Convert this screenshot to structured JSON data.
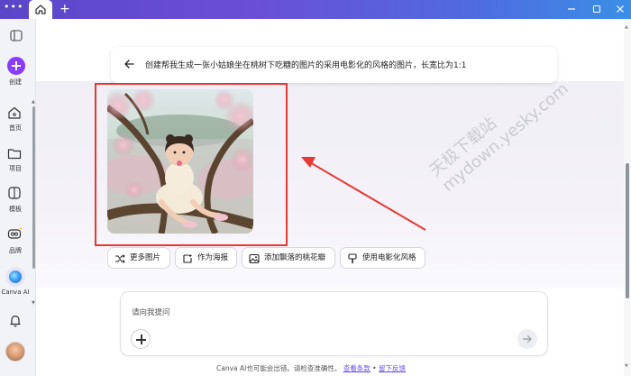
{
  "titlebar": {
    "menu_label": "•••",
    "new_tab_label": "+",
    "window_controls": [
      "minimize-icon",
      "maximize-icon",
      "close-icon"
    ]
  },
  "sidebar": {
    "create_label": "创建",
    "items": [
      {
        "label": "首页",
        "icon": "home-icon"
      },
      {
        "label": "项目",
        "icon": "folder-icon"
      },
      {
        "label": "模板",
        "icon": "template-icon"
      },
      {
        "label": "品牌",
        "icon": "brand-icon"
      },
      {
        "label": "Canva AI",
        "icon": "canva-ai-icon"
      }
    ]
  },
  "prompt": {
    "text": "创建帮我生成一张小姑娘坐在桃树下吃糖的图片的采用电影化的风格的图片，长宽比为1:1"
  },
  "chips": [
    {
      "label": "更多图片",
      "icon": "shuffle-icon"
    },
    {
      "label": "作为海报",
      "icon": "poster-icon"
    },
    {
      "label": "添加飘落的桃花瓣",
      "icon": "image-edit-icon"
    },
    {
      "label": "使用电影化风格",
      "icon": "brush-icon"
    }
  ],
  "watermark": {
    "line1": "天极下载站",
    "line2": "mydown.yesky.com"
  },
  "input": {
    "placeholder": "请向我提问"
  },
  "disclaimer": {
    "text": "Canva AI也可能会出错。请检查准确性。",
    "link1": "查看条款",
    "separator": " • ",
    "link2": "留下反馈"
  },
  "colors": {
    "accent": "#8b3dff",
    "highlight": "#e53935",
    "link": "#6b4ee6"
  }
}
